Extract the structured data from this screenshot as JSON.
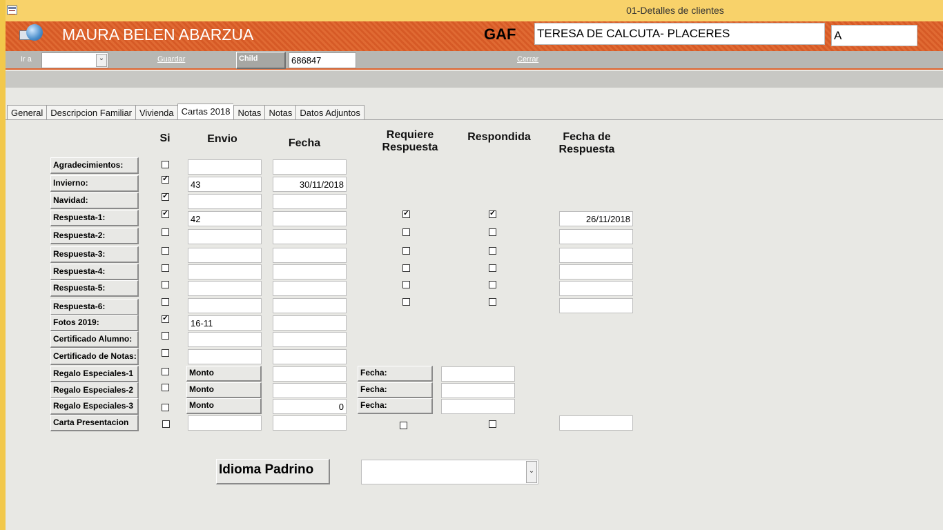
{
  "window": {
    "title": "01-Detalles de clientes"
  },
  "header": {
    "client_name": "MAURA BELEN ABARZUA",
    "gaf_label": "GAF",
    "organization": "TERESA DE CALCUTA- PLACERES",
    "code": "A"
  },
  "toolbar": {
    "goto_label": "Ir a",
    "goto_value": "",
    "save_label": "Guardar",
    "child_label": "Child",
    "child_id": "686847",
    "close_label": "Cerrar"
  },
  "tabs": [
    "General",
    "Descripcion Familiar",
    "Vivienda",
    "Cartas 2018",
    "Notas",
    "Notas",
    "Datos Adjuntos"
  ],
  "active_tab": "Cartas 2018",
  "columns": {
    "si": "Si",
    "envio": "Envio",
    "fecha": "Fecha",
    "requiere": "Requiere Respuesta",
    "respondida": "Respondida",
    "fecha_respuesta": "Fecha de Respuesta"
  },
  "rows": [
    {
      "label": "Agradecimientos:",
      "si": false,
      "envio": "",
      "fecha": ""
    },
    {
      "label": "Invierno:",
      "si": true,
      "envio": "43",
      "fecha": "30/11/2018"
    },
    {
      "label": "Navidad:",
      "si": true,
      "envio": "",
      "fecha": ""
    },
    {
      "label": "Respuesta-1:",
      "si": true,
      "envio": "42",
      "fecha": "",
      "requiere": true,
      "respondida": true,
      "fecha_respuesta": "26/11/2018"
    },
    {
      "label": "Respuesta-2:",
      "si": false,
      "envio": "",
      "fecha": "",
      "requiere": false,
      "respondida": false,
      "fecha_respuesta": ""
    },
    {
      "label": "Respuesta-3:",
      "si": false,
      "envio": "",
      "fecha": "",
      "requiere": false,
      "respondida": false,
      "fecha_respuesta": ""
    },
    {
      "label": "Respuesta-4:",
      "si": false,
      "envio": "",
      "fecha": "",
      "requiere": false,
      "respondida": false,
      "fecha_respuesta": ""
    },
    {
      "label": "Respuesta-5:",
      "si": false,
      "envio": "",
      "fecha": "",
      "requiere": false,
      "respondida": false,
      "fecha_respuesta": ""
    },
    {
      "label": "Respuesta-6:",
      "si": false,
      "envio": "",
      "fecha": "",
      "requiere": false,
      "respondida": false,
      "fecha_respuesta": ""
    },
    {
      "label": "Fotos 2019:",
      "si": true,
      "envio": "16-11",
      "fecha": ""
    },
    {
      "label": "Certificado Alumno:",
      "si": false,
      "envio": "",
      "fecha": ""
    },
    {
      "label": "Certificado de Notas:",
      "si": false,
      "envio": "",
      "fecha": ""
    },
    {
      "label": "Regalo Especiales-1",
      "si": false,
      "monto_label": "Monto",
      "monto": "",
      "fecha_label": "Fecha:",
      "fecha_regalo": ""
    },
    {
      "label": "Regalo Especiales-2",
      "si": false,
      "monto_label": "Monto",
      "monto": "",
      "fecha_label": "Fecha:",
      "fecha_regalo": ""
    },
    {
      "label": "Regalo Especiales-3",
      "si": false,
      "monto_label": "Monto",
      "monto": "0",
      "fecha_label": "Fecha:",
      "fecha_regalo": ""
    },
    {
      "label": "Carta Presentacion",
      "si": false,
      "envio": "",
      "fecha": "",
      "requiere": false,
      "respondida": false,
      "fecha_respuesta": ""
    }
  ],
  "footer": {
    "idioma_label": "Idioma Padrino",
    "idioma_value": ""
  },
  "colors": {
    "header_orange": "#e06a33",
    "title_yellow": "#f8d26a",
    "toolbar_gray": "#b7b7b3"
  }
}
